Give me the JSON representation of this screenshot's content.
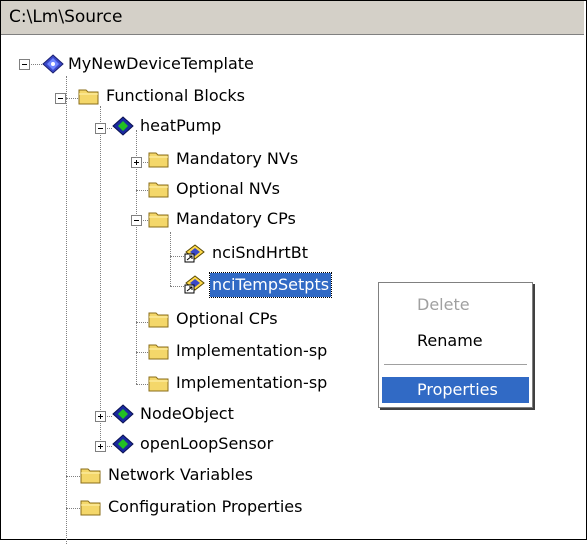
{
  "window": {
    "path": "C:\\Lm\\Source"
  },
  "tree": {
    "root": "MyNewDeviceTemplate",
    "functional_blocks": "Functional Blocks",
    "heat_pump": "heatPump",
    "mandatory_nvs": "Mandatory NVs",
    "optional_nvs": "Optional NVs",
    "mandatory_cps": "Mandatory CPs",
    "nci_snd_hrt_bt": "nciSndHrtBt",
    "nci_temp_setpts": "nciTempSetpts",
    "optional_cps": "Optional CPs",
    "impl_1": "Implementation-sp",
    "impl_2": "Implementation-sp",
    "node_object": "NodeObject",
    "open_loop_sensor": "openLoopSensor",
    "network_variables": "Network Variables",
    "configuration_properties": "Configuration Properties"
  },
  "context_menu": {
    "delete": "Delete",
    "rename": "Rename",
    "properties": "Properties"
  },
  "colors": {
    "selection": "#316ac5",
    "folder": "#f4d76a",
    "device_blue": "#3a48c8",
    "fb_green": "#22c022"
  }
}
